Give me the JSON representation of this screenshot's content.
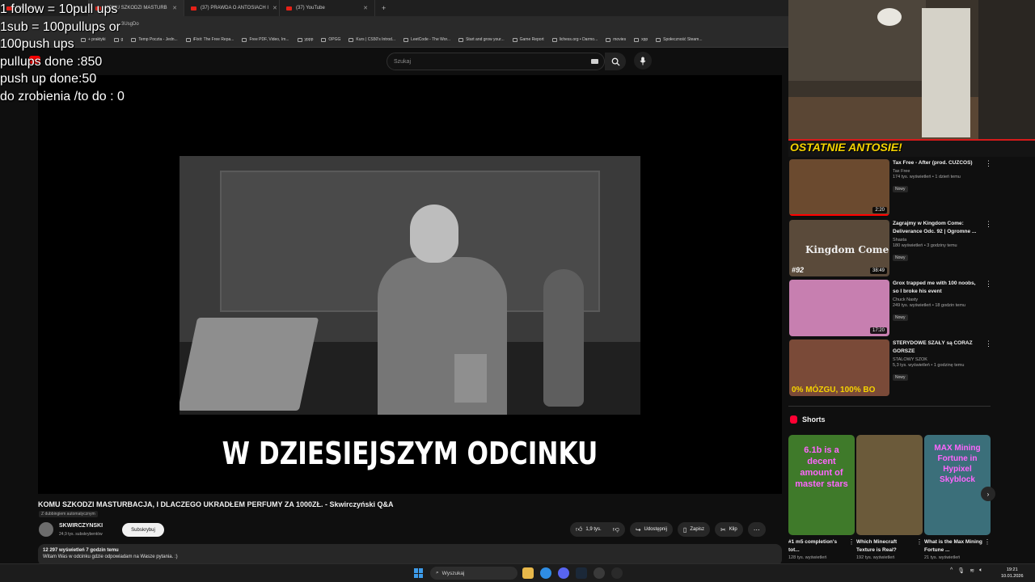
{
  "overlay": {
    "lines": [
      "1 follow = 10pull ups",
      "1sub = 100pullups or",
      "100push ups",
      "pullups done :850",
      "push up done:50",
      "do zrobienia /to do : 0"
    ]
  },
  "browser": {
    "tabs": [
      {
        "label": "YouTube"
      },
      {
        "label": "KOMU SZKODZI MASTURB"
      },
      {
        "label": "(37) PRAWDA O ANTOSIACH I"
      },
      {
        "label": "(37) YouTube"
      }
    ],
    "address": "3UsgDo",
    "bookmarks": [
      "+ praktyki",
      "g",
      "Temp Poczta - Jedn...",
      "iFixit: The Free Repa...",
      "Free PDF, Video, Im...",
      "yppp",
      "OPGG",
      "Kurs | CS50's Introd...",
      "LeetCode - The Wor...",
      "Start and grow your...",
      "Game Report",
      "lichess.org • Darmo...",
      "movies",
      "xpp",
      "Społeczność Steam..."
    ]
  },
  "youtube": {
    "search_placeholder": "Szukaj",
    "video": {
      "caption": "W DZIESIEJSZYM ODCINKU",
      "title": "KOMU SZKODZI MASTURBACJA, I DLACZEGO UKRADŁEM PERFUMY ZA 1000ZŁ. - Skwirczyński Q&A",
      "dubbing": "Z dubbingiem automatycznym",
      "channel": "SKWIRCZYNSKI",
      "subscribers": "24,9 tys. subskrybentów",
      "subscribe_label": "Subskrybuj",
      "likes": "1,9 tys.",
      "share_label": "Udostępnij",
      "save_label": "Zapisz",
      "clip_label": "Klip",
      "views_line": "12 297 wyświetleń  7 godzin temu",
      "description": "Witam Was w odcinku gdzie odpowiadam na Wasze pytania. :)"
    },
    "banner": "OSTATNIE ANTOSIE!",
    "sidebar": [
      {
        "title": "Tax Free - After (prod. CUZCOS)",
        "channel": "Tax Free",
        "meta": "174 tys. wyświetleń • 1 dzień temu",
        "badge": "Nowy",
        "duration": "2:20",
        "progress": 1.0,
        "thumb_color": "#6b4a2f"
      },
      {
        "title": "Zagrajmy w Kingdom Come: Deliverance Odc. 92 | Ogromne ...",
        "channel": "Shasta",
        "meta": "180 wyświetleń • 3 godziny temu",
        "badge": "Nowy",
        "duration": "38:49",
        "progress": 0.0,
        "thumb_color": "#5a4a3a"
      },
      {
        "title": "Grox trapped me with 100 noobs, so I broke his event",
        "channel": "Chuck Nasty",
        "meta": "249 tys. wyświetleń • 18 godzin temu",
        "badge": "Nowy",
        "duration": "17:20",
        "progress": 0.0,
        "thumb_color": "#c77fb0"
      },
      {
        "title": "STERYDOWE SZAŁY są CORAZ GORSZE",
        "channel": "STALOWY SZOK",
        "meta": "5,3 tys. wyświetleń • 1 godzinę temu",
        "badge": "Nowy",
        "duration": "",
        "progress": 0.0,
        "thumb_color": "#7a4a38"
      }
    ],
    "sidebar_thumb_texts": [
      "",
      "Kingdom Come",
      "",
      "0% MÓZGU, 100% BO"
    ],
    "sidebar_thumb_tags": [
      "",
      "#92",
      "",
      ""
    ],
    "shorts_heading": "Shorts",
    "shorts": [
      {
        "title": "#1 m5 completion's tot...",
        "views": "128 tys. wyświetleń",
        "thumb_text": "6.1b is a decent amount of master stars",
        "thumb_color": "#3f7a2a"
      },
      {
        "title": "Which Minecraft Texture is Real?",
        "views": "192 tys. wyświetleń",
        "thumb_text": "",
        "thumb_color": "#6b5a3a"
      },
      {
        "title": "What is the Max Mining Fortune ...",
        "views": "21 tys. wyświetleń",
        "thumb_text": "MAX Mining Fortune in Hypixel Skyblock",
        "thumb_color": "#3b6f7a"
      }
    ]
  },
  "taskbar": {
    "search_label": "Wyszukaj",
    "time": "19:21",
    "date": "10.01.2026"
  }
}
